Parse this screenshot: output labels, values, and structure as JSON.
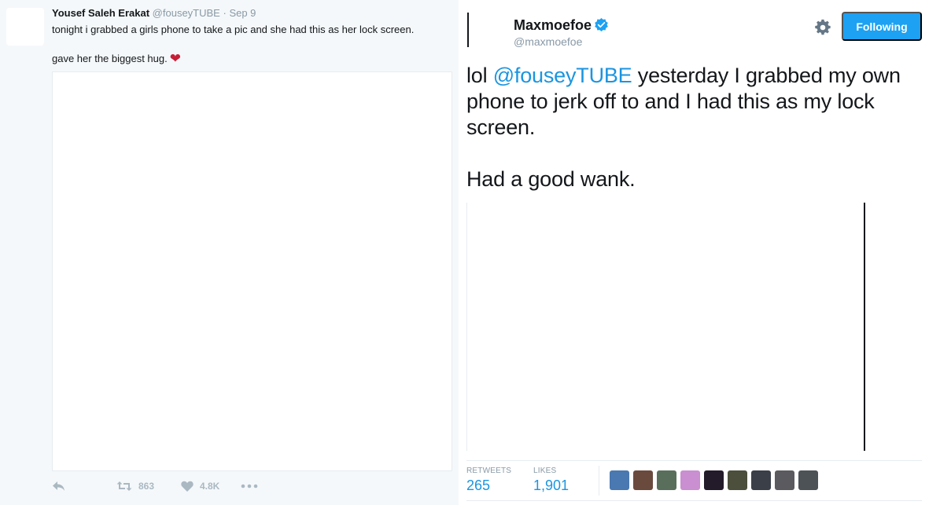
{
  "quoted_tweet": {
    "author_name": "Yousef Saleh Erakat",
    "author_handle": "@fouseyTUBE",
    "separator": "·",
    "date": "Sep 9",
    "text_line1": "tonight i grabbed a girls phone to take a pic and she had this as her lock screen.",
    "text_line2": "gave her the biggest hug.",
    "emoji": "❤",
    "actions": {
      "retweet_count": "863",
      "like_count": "4.8K"
    }
  },
  "main_tweet": {
    "user_name": "Maxmoefoe",
    "user_handle": "@maxmoefoe",
    "follow_label": "Following",
    "text_prefix": "lol ",
    "mention": "@fouseyTUBE",
    "text_rest": " yesterday I grabbed my own phone to jerk off to and I had this as my lock screen.",
    "text_para2": "Had a good wank.",
    "stats": {
      "retweets_label": "RETWEETS",
      "retweets_value": "265",
      "likes_label": "LIKES",
      "likes_value": "1,901"
    },
    "liker_avatar_colors": [
      "#4a78b0",
      "#6b4a3e",
      "#5a6e5c",
      "#c98fd0",
      "#231a2a",
      "#4b4f3b",
      "#3a3f48",
      "#5b5a5e",
      "#4d5257"
    ]
  },
  "colors": {
    "accent": "#1da1f2",
    "link": "#1b95e0",
    "muted": "#8899a6",
    "heart": "#c81d36"
  }
}
